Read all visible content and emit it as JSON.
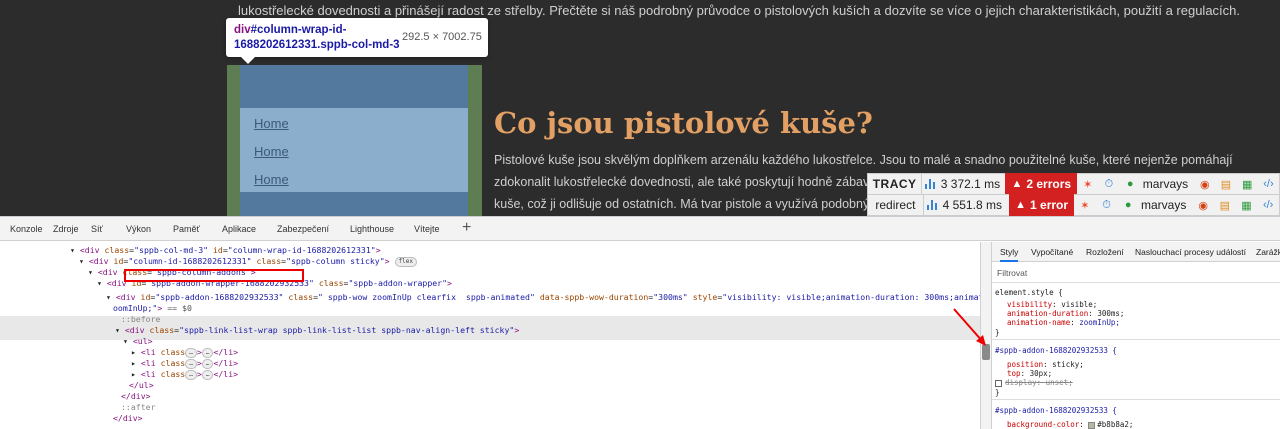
{
  "page": {
    "top_text": "lukostřelecké dovednosti a přinášejí radost ze střelby. Přečtěte si náš podrobný průvodce o pistolových kuších a dozvíte se více o  jejich charakteristikách, použití a regulacích.",
    "nav_links": [
      "Home",
      "Home",
      "Home"
    ],
    "heading": "Co jsou pistolové kuše?",
    "body_lines": [
      "Pistolové kuše  jsou skvělým doplňkem arzenálu každého lukostřelce. Jsou to malé a snadno použitelné kuše, které nejenže pomáhají",
      "zdokonalit lukostřelecké dovednosti, ale také poskytují hodně zábavy p",
      "kuše, což  ji odlišuje od ostatních. Má tvar pistole a využívá podobný m"
    ]
  },
  "tooltip": {
    "tag": "div",
    "selector": "#column-wrap-id-1688202612331.sppb-col-md-3",
    "size": "292.5 × 7002.75"
  },
  "tracy": {
    "rows": [
      {
        "label": "TRACY",
        "time": "3 372.1 ms",
        "errors": "2 errors",
        "user": "marvays"
      },
      {
        "label": "redirect",
        "time": "4 551.8 ms",
        "errors": "1 error",
        "user": "marvays"
      }
    ],
    "icons": [
      "joomla-icon",
      "stopwatch-icon",
      "user-icon",
      "globe-icon",
      "file-icon",
      "db-icon",
      "code-icon"
    ]
  },
  "devtools": {
    "tabs": [
      "Konzole",
      "Zdroje",
      "Síť",
      "Výkon",
      "Paměť",
      "Aplikace",
      "Zabezpečení",
      "Lighthouse",
      "Vítejte"
    ],
    "dom": {
      "l1": {
        "open": "<div",
        "attr1": "class",
        "val1": "\"sppb-col-md-3\"",
        "attr2": "id",
        "val2": "\"column-wrap-id-1688202612331\"",
        "close": ">"
      },
      "l2": {
        "open": "<div",
        "attr1": "id",
        "val1": "\"column-id-1688202612331\"",
        "attr2": "class",
        "val2": "\"sppb-column sticky\"",
        "close": ">",
        "pill": "flex"
      },
      "l3": {
        "open": "<div",
        "attr1": "class",
        "val1": "\"sppb-column-addons\"",
        "close": ">"
      },
      "l4": {
        "open": "<div",
        "attr1": "id",
        "val1": "\"sppb-addon-wrapper-1688202932533\"",
        "attr2": "class",
        "val2": "\"sppb-addon-wrapper\"",
        "close": ">"
      },
      "l5a": {
        "open": "<div",
        "attr1": "id",
        "val1": "\"sppb-addon-1688202932533\"",
        "attr2": "class",
        "val2": "\" sppb-wow zoomInUp clearfix  sppb-animated\"",
        "attr3": "data-sppb-wow-duration",
        "val3": "\"300ms\"",
        "attr4": "style",
        "val4": "\"visibility: visible;animation-duration: 300ms;animation-name: z"
      },
      "l5b": {
        "val": "oomInUp;\"",
        "close": ">",
        "eq": "== $0"
      },
      "before": "::before",
      "l6": {
        "open": "<div",
        "attr1": "class",
        "val1": "\"sppb-link-list-wrap sppb-link-list-list sppb-nav-align-left sticky\"",
        "close": ">"
      },
      "ul_open": "<ul>",
      "li": {
        "open": "<li",
        "attr": "class",
        "close": "</li>",
        "ellipsis": "…"
      },
      "ul_close": "</ul>",
      "div_close": "</div>",
      "after": "::after"
    },
    "styles_tabs": [
      "Styly",
      "Vypočítané",
      "Rozložení",
      "Naslouchací procesy událostí",
      "Zarážky"
    ],
    "filter": "Filtrovat",
    "element_style": {
      "selector": "element.style {",
      "props": [
        {
          "name": "visibility",
          "value": "visible;"
        },
        {
          "name": "animation-duration",
          "value": "300ms;"
        },
        {
          "name": "animation-name",
          "value": "zoomInUp;"
        }
      ],
      "close": "}"
    },
    "rule1": {
      "selector": "#sppb-addon-1688202932533 {",
      "props": [
        {
          "name": "position",
          "value": "sticky;"
        },
        {
          "name": "top",
          "value": "30px;"
        },
        {
          "name": "display",
          "value": "unset;"
        }
      ],
      "close": "}"
    },
    "rule2": {
      "selector": "#sppb-addon-1688202932533 {",
      "props": [
        {
          "name": "background-color",
          "value": "#b8b8a2;"
        }
      ]
    }
  },
  "colors": {
    "heading": "#e3a064",
    "highlight_box": "#e00000",
    "tracy_error": "#d32121"
  }
}
